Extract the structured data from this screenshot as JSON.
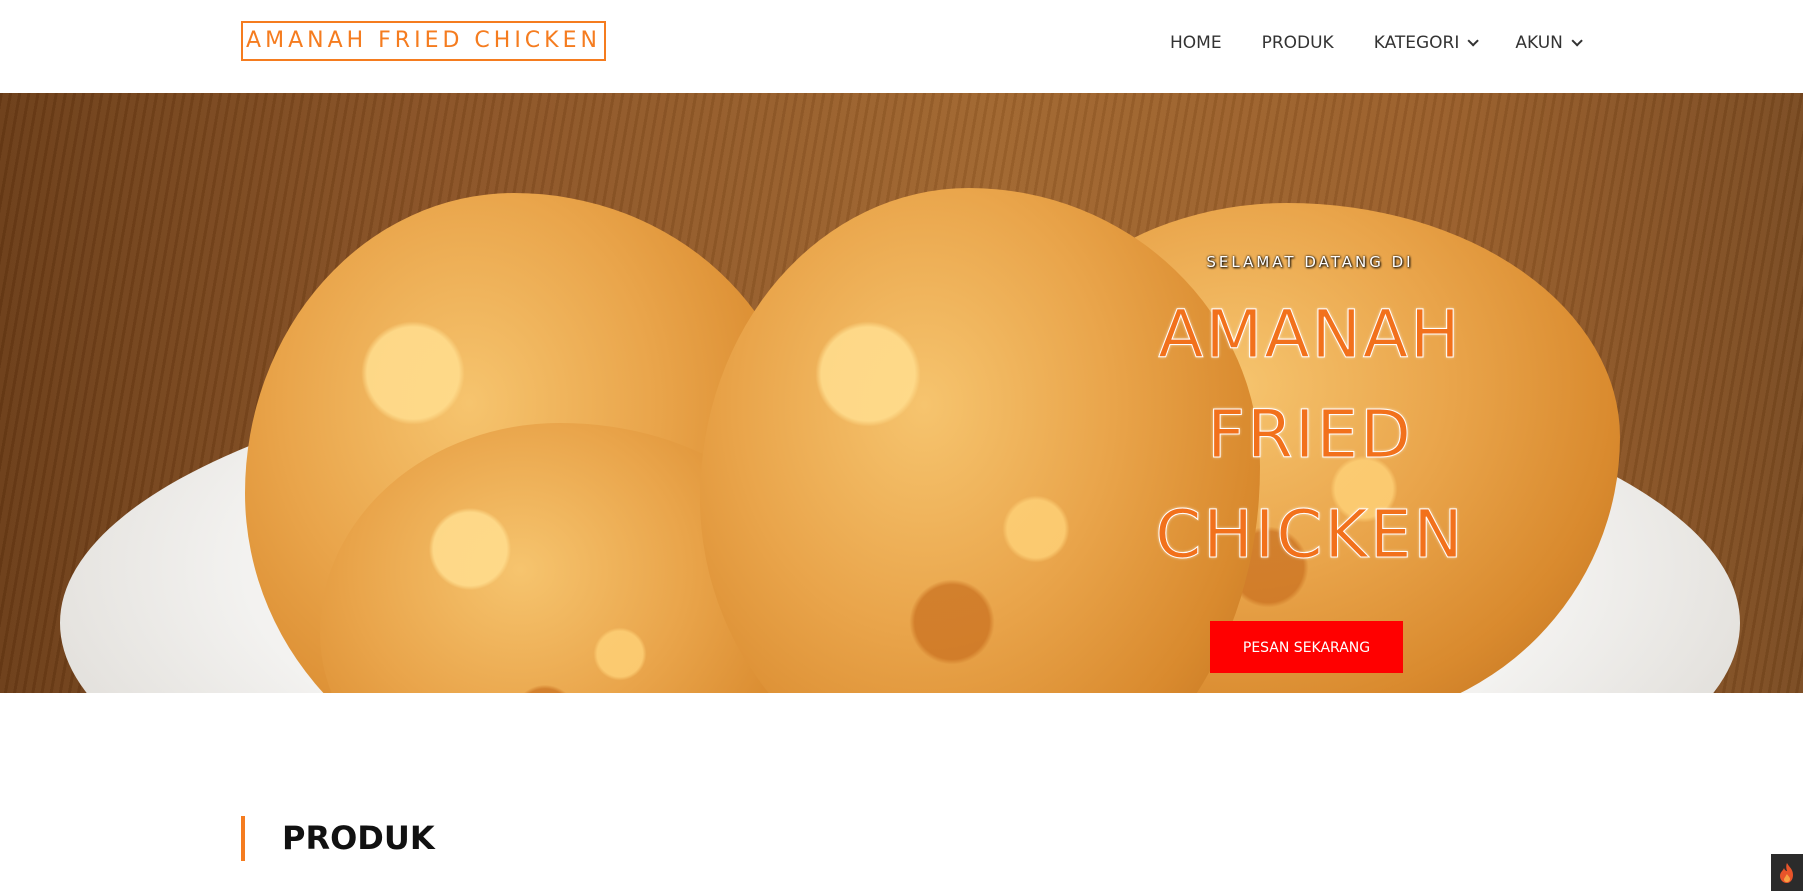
{
  "navbar": {
    "brand": "AMANAH FRIED CHICKEN",
    "items": [
      {
        "label": "HOME",
        "dropdown": false
      },
      {
        "label": "PRODUK",
        "dropdown": false
      },
      {
        "label": "KATEGORI",
        "dropdown": true
      },
      {
        "label": "AKUN",
        "dropdown": true
      }
    ]
  },
  "hero": {
    "welcome": "SELAMAT DATANG DI",
    "title_lines": [
      "AMANAH",
      "FRIED",
      "CHICKEN"
    ],
    "cta_label": "PESAN SEKARANG"
  },
  "section": {
    "title": "PRODUK"
  },
  "colors": {
    "accent": "#f57c1f",
    "cta": "#ff0000"
  },
  "icons": {
    "dropdown": "chevron-down-icon",
    "floating": "fire-icon"
  }
}
